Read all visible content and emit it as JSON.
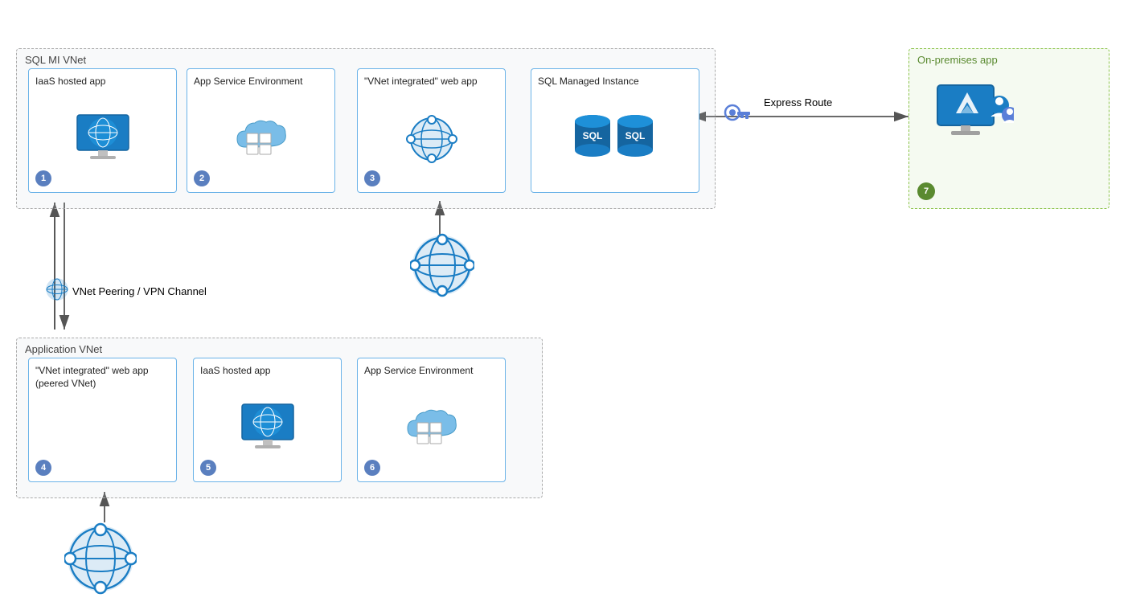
{
  "sql_mi_vnet": {
    "label": "SQL MI VNet",
    "components": [
      {
        "id": "1",
        "title": "IaaS hosted app",
        "icon": "monitor",
        "badge": "1"
      },
      {
        "id": "2",
        "title": "App Service Environment",
        "icon": "app-service-env",
        "badge": "2"
      },
      {
        "id": "3",
        "title": "\"VNet integrated\" web app",
        "icon": "vnet",
        "badge": "3"
      },
      {
        "id": "4",
        "title": "SQL Managed Instance",
        "icon": "sql",
        "badge": ""
      }
    ]
  },
  "application_vnet": {
    "label": "Application VNet",
    "components": [
      {
        "id": "4",
        "title": "\"VNet integrated\" web app (peered VNet)",
        "icon": "vnet",
        "badge": "4"
      },
      {
        "id": "5",
        "title": "IaaS hosted app",
        "icon": "monitor",
        "badge": "5"
      },
      {
        "id": "6",
        "title": "App Service Environment",
        "icon": "app-service-env",
        "badge": "6"
      }
    ]
  },
  "onprem": {
    "label": "On-premises app",
    "badge": "7"
  },
  "arrows": {
    "express_route": "Express Route",
    "vnet_peering": "VNet Peering / VPN Channel"
  }
}
